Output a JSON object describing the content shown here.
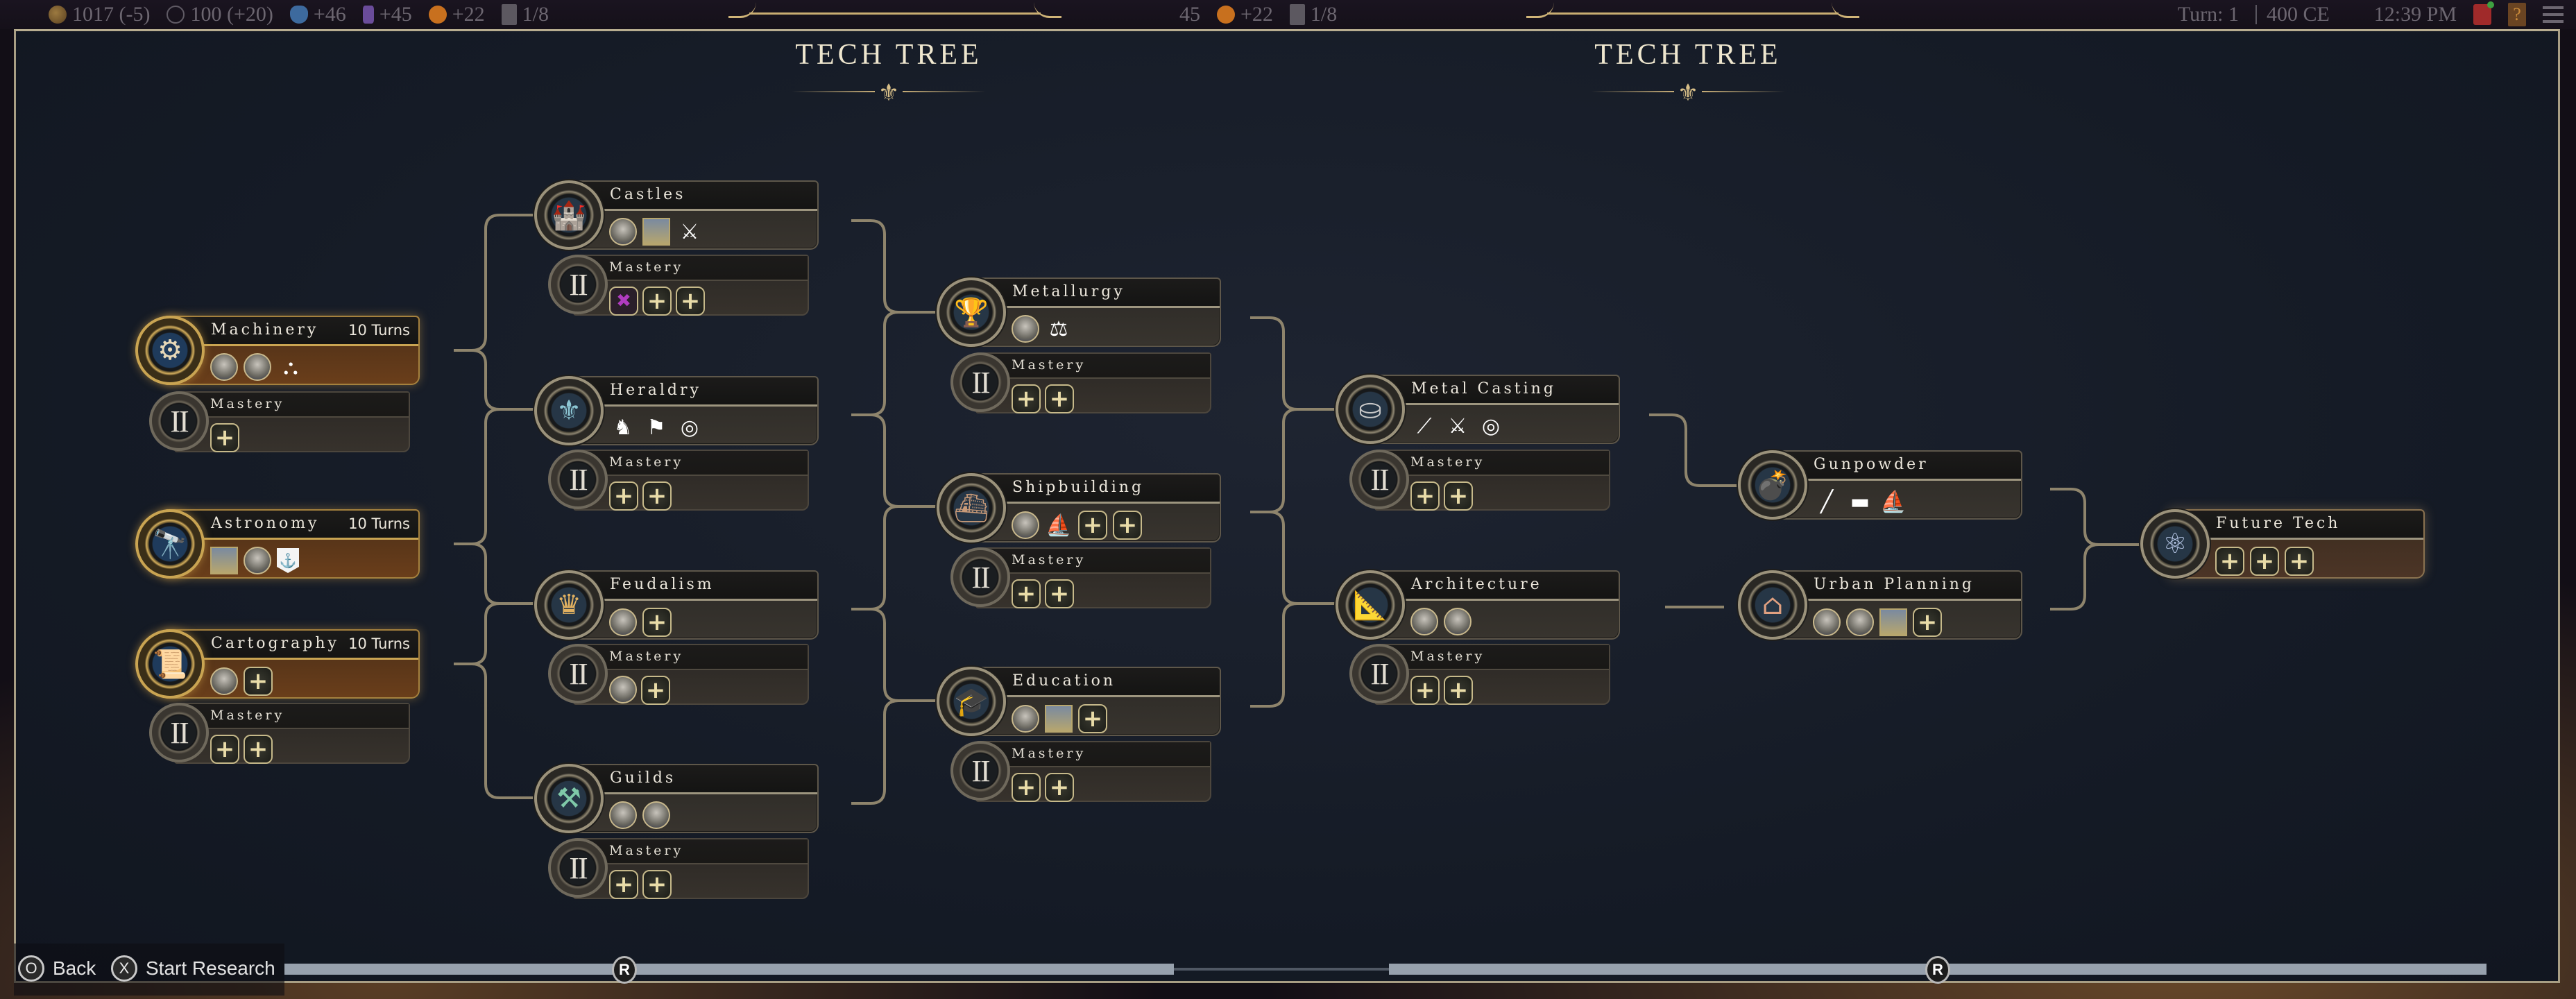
{
  "top_bar": {
    "resources": [
      {
        "icon": "gold-icon",
        "value": "1017 (-5)"
      },
      {
        "icon": "influence-globe-icon",
        "value": "100 (+20)"
      },
      {
        "icon": "science-flask-icon",
        "value": "+46"
      },
      {
        "icon": "culture-music-icon",
        "value": "+45"
      },
      {
        "icon": "happiness-icon",
        "value": "+22"
      },
      {
        "icon": "settlements-icon",
        "value": "1/8"
      }
    ],
    "resources_mirror": [
      {
        "icon": "culture-music-icon",
        "value": "45"
      },
      {
        "icon": "happiness-icon",
        "value": "+22"
      },
      {
        "icon": "settlements-icon",
        "value": "1/8"
      }
    ],
    "turn": "Turn: 1",
    "year": "400 CE",
    "clock": "12:39 PM",
    "help_label": "?"
  },
  "titles": [
    "TECH TREE",
    "TECH TREE"
  ],
  "techs": {
    "machinery": {
      "name": "Machinery",
      "turns": "10 Turns",
      "icon": "gears-icon",
      "unlocks": [
        "building-icon",
        "building-icon",
        "catapult-icon"
      ]
    },
    "astronomy": {
      "name": "Astronomy",
      "turns": "10 Turns",
      "icon": "telescope-icon",
      "unlocks": [
        "wonder-icon",
        "building-icon",
        "anchor-civic-icon"
      ]
    },
    "cartography": {
      "name": "Cartography",
      "turns": "10 Turns",
      "icon": "map-scroll-icon",
      "unlocks": [
        "building-icon",
        "plus-icon"
      ]
    },
    "castles": {
      "name": "Castles",
      "icon": "castle-icon",
      "unlocks": [
        "building-icon",
        "wonder-icon",
        "crossbow-icon"
      ]
    },
    "heraldry": {
      "name": "Heraldry",
      "icon": "fleur-de-lis-shield-icon",
      "unlocks": [
        "knight-helmet-icon",
        "banner-flag-icon",
        "ring-icon"
      ]
    },
    "feudalism": {
      "name": "Feudalism",
      "icon": "crown-icon",
      "unlocks": [
        "building-icon",
        "plus-icon"
      ]
    },
    "guilds": {
      "name": "Guilds",
      "icon": "crossed-hammers-icon",
      "unlocks": [
        "building-icon",
        "building-icon"
      ]
    },
    "metallurgy": {
      "name": "Metallurgy",
      "icon": "crucible-icon",
      "unlocks": [
        "building-icon",
        "trebuchet-icon"
      ]
    },
    "shipbuilding": {
      "name": "Shipbuilding",
      "icon": "ship-frame-icon",
      "unlocks": [
        "building-icon",
        "galleon-icon",
        "plus-icon",
        "plus-icon"
      ]
    },
    "education": {
      "name": "Education",
      "icon": "graduation-cap-icon",
      "unlocks": [
        "building-icon",
        "wonder-icon",
        "plus-icon"
      ]
    },
    "metal_casting": {
      "name": "Metal Casting",
      "icon": "metal-ingots-icon",
      "unlocks": [
        "pike-icon",
        "halberd-icon",
        "ring-icon"
      ]
    },
    "architecture": {
      "name": "Architecture",
      "icon": "drafting-compass-icon",
      "unlocks": [
        "building-icon",
        "building-icon"
      ]
    },
    "gunpowder": {
      "name": "Gunpowder",
      "icon": "cannon-icon",
      "unlocks": [
        "musket-icon",
        "cannon-unit-icon",
        "fire-ship-icon"
      ]
    },
    "urban_planning": {
      "name": "Urban Planning",
      "icon": "houses-icon",
      "unlocks": [
        "building-icon",
        "building-icon",
        "wonder-icon",
        "plus-icon"
      ]
    },
    "future_tech": {
      "name": "Future Tech",
      "icon": "atom-icon",
      "unlocks": [
        "plus-icon",
        "plus-icon",
        "plus-icon"
      ]
    }
  },
  "mastery": {
    "label": "Mastery",
    "numeral": "II",
    "machinery": [
      "plus-icon"
    ],
    "cartography": [
      "plus-icon",
      "plus-icon"
    ],
    "castles": [
      "promotion-axes-icon",
      "plus-icon",
      "plus-icon"
    ],
    "heraldry": [
      "plus-icon",
      "plus-icon"
    ],
    "feudalism": [
      "building-icon",
      "plus-icon"
    ],
    "guilds": [
      "plus-icon",
      "plus-icon"
    ],
    "metallurgy": [
      "plus-icon",
      "plus-icon"
    ],
    "shipbuilding": [
      "plus-icon",
      "plus-icon"
    ],
    "education": [
      "plus-icon",
      "plus-icon"
    ],
    "metal_casting": [
      "plus-icon",
      "plus-icon"
    ],
    "architecture": [
      "plus-icon",
      "plus-icon"
    ]
  },
  "bottom_bar": {
    "back_button": "O",
    "back_label": "Back",
    "start_button": "X",
    "start_label": "Start Research",
    "scroll_button": "R"
  },
  "colors": {
    "accent_gold": "#c9a452",
    "panel_bg": "#151b26",
    "connector": "#8e846c"
  }
}
